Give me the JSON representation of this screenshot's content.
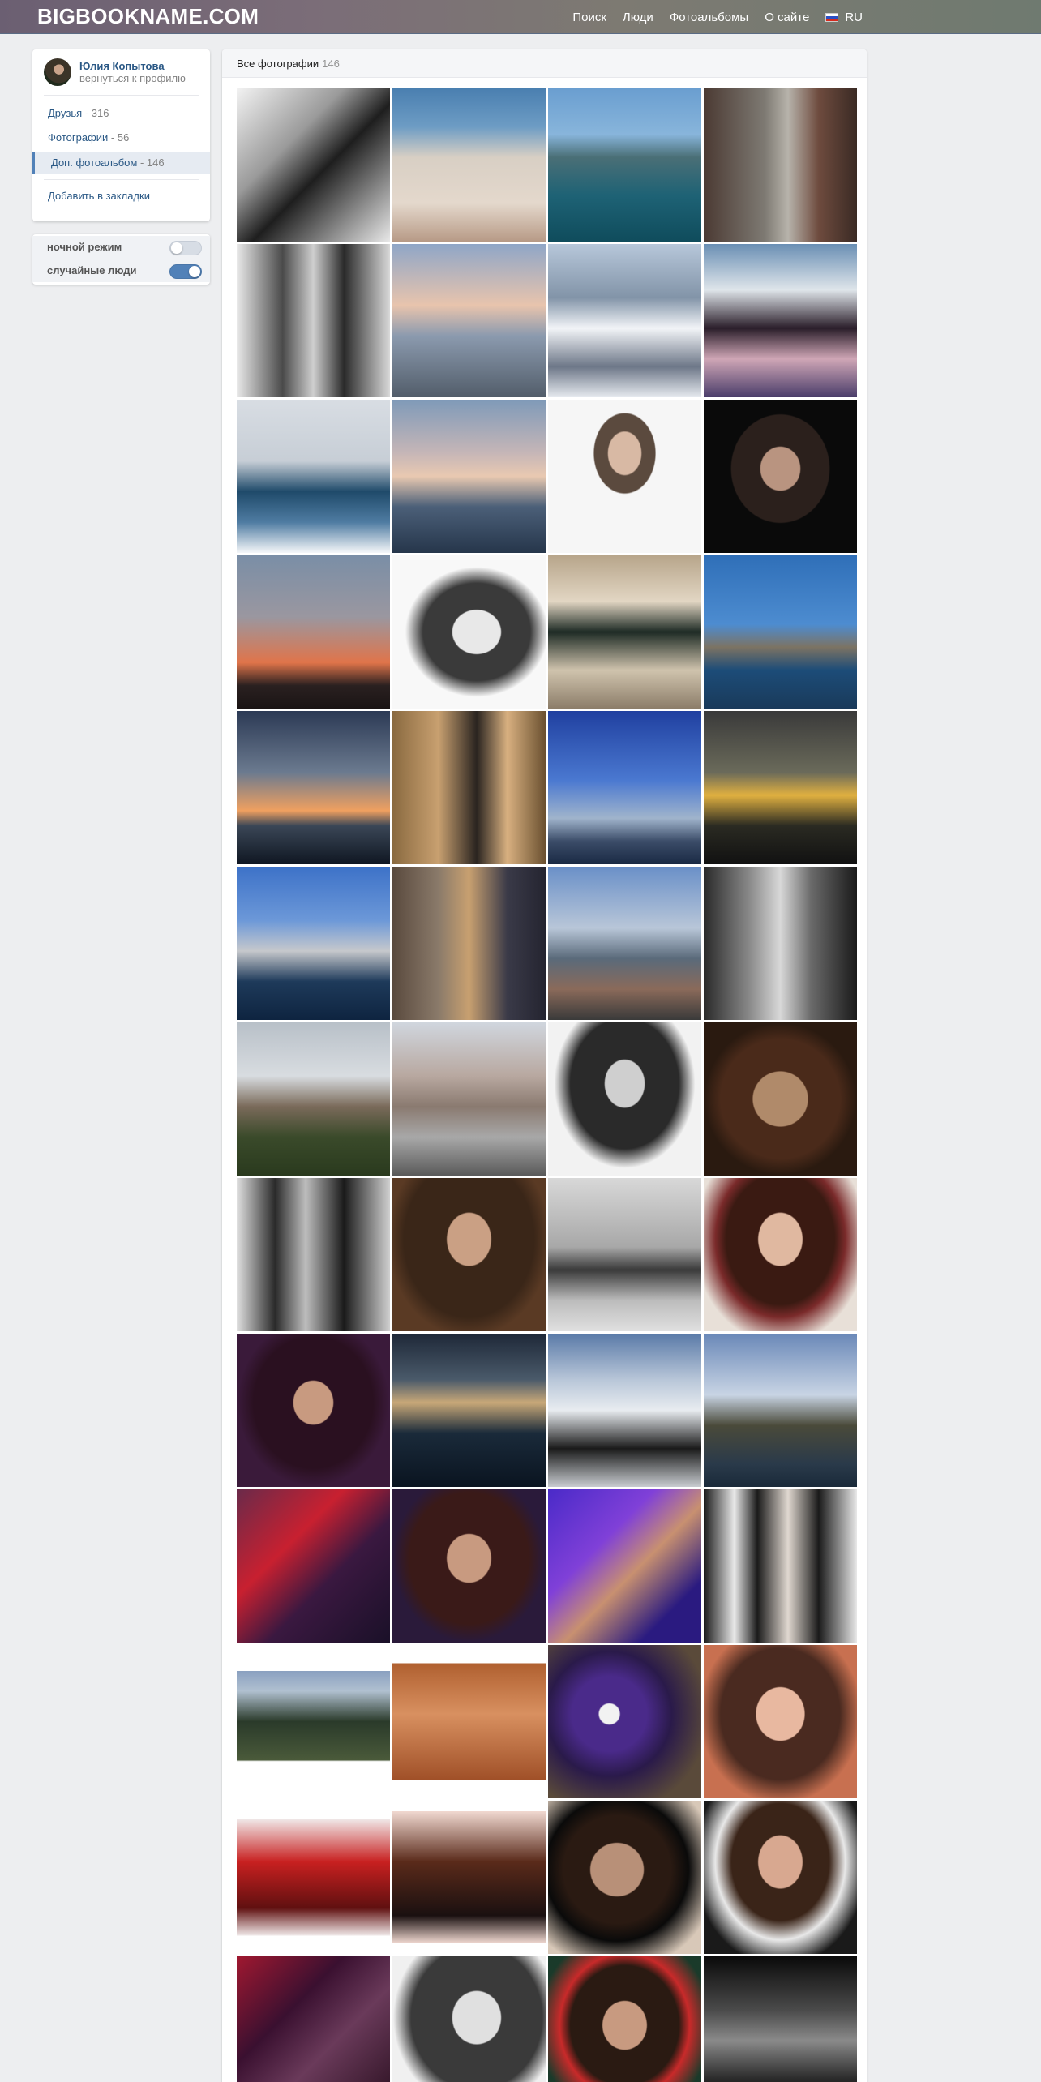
{
  "header": {
    "logo": "BIGBOOKNAME.COM",
    "nav": [
      "Поиск",
      "Люди",
      "Фотоальбомы",
      "О сайте"
    ],
    "lang": "RU"
  },
  "profile": {
    "name": "Юлия Копытова",
    "back": "вернуться к профилю",
    "menu": [
      {
        "label": "Друзья",
        "count": "316"
      },
      {
        "label": "Фотографии",
        "count": "56"
      },
      {
        "label": "Доп. фотоальбом",
        "count": "146"
      }
    ],
    "bookmark": "Добавить в закладки"
  },
  "toggles": [
    {
      "label": "ночной режим",
      "on": false
    },
    {
      "label": "случайные люди",
      "on": true
    }
  ],
  "album": {
    "title": "Все фотографии",
    "count": "146"
  },
  "photos": [
    {
      "bg": "linear-gradient(135deg,#f2f2f2 0%,#9a9a9a 35%,#1e1e1e 55%,#e8e8e8 100%)"
    },
    {
      "bg": "linear-gradient(180deg,#4a7fb0 0%,#6d9cc4 25%,#d8cfc4 45%,#e4d8cc 75%,#b79a86 100%)"
    },
    {
      "bg": "linear-gradient(180deg,#6a9ed0 0%,#88b5db 30%,#4a6f76 45%,#1e6275 70%,#0f4c5c 100%)"
    },
    {
      "bg": "linear-gradient(90deg,#4b3a33 0%,#7e7a73 40%,#b7b3ab 55%,#6e4b3e 75%,#3a2a24 100%)"
    },
    {
      "bg": "linear-gradient(90deg,#e9e9e9 0%,#4a4a4a 30%,#cfcfcf 50%,#2a2a2a 70%,#d9d9d9 100%)"
    },
    {
      "bg": "linear-gradient(180deg,#8fa6c7 0%,#e8c4ad 40%,#8b9aae 60%,#525d6a 100%)"
    },
    {
      "bg": "linear-gradient(180deg,#b7c7da 0%,#8294a8 35%,#f2f4f7 55%,#6d7788 80%,#e6eaef 100%)"
    },
    {
      "bg": "linear-gradient(180deg,#6a8fb4 0%,#dfe5ea 30%,#2a1e2a 55%,#cfa6b6 75%,#4a3d6a 100%)"
    },
    {
      "bg": "linear-gradient(180deg,#d8dde3 0%,#c7ced6 40%,#1f4a6a 60%,#4f7ca2 80%,#f5f7f9 100%)"
    },
    {
      "bg": "linear-gradient(180deg,#7f9ab8 0%,#c6b6b7 35%,#e9c9b1 50%,#4b5f78 70%,#26364b 100%)"
    },
    {
      "bg": "radial-gradient(ellipse at 50% 35%,#d8b9a4 0 15%,#5b4a3e 16% 28%,#f6f6f6 29%),linear-gradient(#f6f6f6,#f6f6f6)"
    },
    {
      "bg": "radial-gradient(ellipse at 50% 45%,#b99480 0 18%,#2b201c 19% 45%,#0a0a0a 46%)"
    },
    {
      "bg": "linear-gradient(180deg,#7a8ea6 0%,#9a97a0 40%,#e0744a 70%,#2a2020 85%,#1a1414 100%)"
    },
    {
      "bg": "radial-gradient(ellipse at 55% 50%,#e8e8e8 0 20%,#3a3a3a 21% 45%,#f8f8f8 60%)"
    },
    {
      "bg": "linear-gradient(180deg,#b7a58a 0%,#e2d6c3 30%,#1e2b25 50%,#cfc3ad 75%,#8c7d69 100%)"
    },
    {
      "bg": "linear-gradient(180deg,#2f6fb8 0%,#4d8cd0 45%,#7c7363 60%,#1c4c78 75%,#1a3a5a 100%)"
    },
    {
      "bg": "linear-gradient(180deg,#2c3a55 0%,#6b7a8f 40%,#f0a060 65%,#3a4656 75%,#0f1622 100%)"
    },
    {
      "bg": "linear-gradient(90deg,#8a6a40 0%,#c8a070 30%,#2a2420 55%,#d8b080 75%,#6a5030 100%)"
    },
    {
      "bg": "linear-gradient(180deg,#2040a0 0%,#4a78d0 45%,#a0b4cc 70%,#3b4c68 85%,#1a2a44 100%)"
    },
    {
      "bg": "linear-gradient(180deg,#3a3a3a 0%,#6a6a5a 40%,#e0b040 55%,#2a2a22 75%,#111 100%)"
    },
    {
      "bg": "linear-gradient(180deg,#3d72c8 0%,#6c98d8 35%,#c6c8cc 55%,#1e3a5a 75%,#0e2440 100%)"
    },
    {
      "bg": "linear-gradient(90deg,#5a4a3e 0%,#8a7a6a 30%,#c8a070 50%,#3a3a48 75%,#242430 100%)"
    },
    {
      "bg": "linear-gradient(180deg,#6a90c8 0%,#b8c6d8 40%,#5a6a7a 60%,#8a6a5a 80%,#3a3a3a 100%)"
    },
    {
      "bg": "linear-gradient(90deg,#2a2a2a 0%,#8a8a8a 30%,#d8d8d8 50%,#6a6a6a 70%,#1a1a1a 100%)"
    },
    {
      "bg": "linear-gradient(180deg,#b8c0c8 0%,#d8dce0 35%,#7a6a5a 55%,#3a4a2a 75%,#2a3a1e 100%)"
    },
    {
      "bg": "linear-gradient(180deg,#d0d6de 0%,#b8a8a0 35%,#8a7a70 55%,#a8a8a8 75%,#5a5a5a 100%)"
    },
    {
      "bg": "radial-gradient(ellipse at 50% 40%,#cfcfcf 0 18%,#2a2a2a 19% 50%,#f2f2f2 65%)"
    },
    {
      "bg": "radial-gradient(ellipse at 50% 50%,#b08a6a 0 25%,#4a2a1a 26% 55%,#2a1a10 70%)"
    },
    {
      "bg": "linear-gradient(90deg,#e0e0e0 0%,#2a2a2a 25%,#bdbdbd 45%,#1a1a1a 70%,#d0d0d0 100%)"
    },
    {
      "bg": "radial-gradient(ellipse at 50% 40%,#caa084 0 20%,#3a2618 21% 60%,#5a3a24 75%)"
    },
    {
      "bg": "linear-gradient(180deg,#d8d8d8 0%,#a8a8a8 45%,#3a3a3a 60%,#bcbcbc 80%,#e0e0e0 100%)"
    },
    {
      "bg": "radial-gradient(ellipse at 50% 40%,#e0b8a0 0 20%,#3a1a12 21% 50%,#7a2a2a 60%,#e8e0d8 80%)"
    },
    {
      "bg": "radial-gradient(ellipse at 50% 45%,#c89a80 0 18%,#2a1020 19% 55%,#3a1a3a 70%)"
    },
    {
      "bg": "linear-gradient(180deg,#1e2838 0%,#4a5a6a 30%,#c8a878 45%,#1a2a3a 65%,#0a1420 100%)"
    },
    {
      "bg": "linear-gradient(180deg,#5a7aa8 0%,#b8c6d8 30%,#e8ecf0 50%,#1a1a1a 75%,#c8ccd0 100%)"
    },
    {
      "bg": "linear-gradient(180deg,#6a88b8 0%,#c8d4e4 40%,#4a4a3a 60%,#2a3a4a 85%,#1a2a3a 100%)"
    },
    {
      "bg": "linear-gradient(135deg,#6a2a4a 0%,#c82030 35%,#3a1840 60%,#1a1028 100%)"
    },
    {
      "bg": "radial-gradient(ellipse at 50% 45%,#c89a80 0 20%,#3a1a18 21% 55%,#2a1a3a 70%)"
    },
    {
      "bg": "linear-gradient(135deg,#4a2ac8 0%,#8040d8 35%,#c89070 55%,#2a1a80 80%)"
    },
    {
      "bg": "linear-gradient(90deg,#1a1a1a 0%,#e8e8e8 20%,#1a1a1a 35%,#e0d8d0 55%,#1a1a1a 75%,#e8e8e8 100%)"
    },
    {
      "bg": "linear-gradient(180deg,#ffffff 0%,#ffffff 17%,#8aa0c0 17%,#b0c0d0 30%,#2a3a2a 50%,#4a5a3a 75%,#ffffff 76%,#ffffff 100%)"
    },
    {
      "bg": "linear-gradient(180deg,#ffffff 0%,#ffffff 12%,#b06030 12%,#d89060 45%,#a05028 88%,#ffffff 88%,#ffffff 100%)"
    },
    {
      "bg": "radial-gradient(circle at 40% 45%,#f2f2f2 0 8%,#4a2a8a 9% 30%,#2a1a4a 50%,#5a4a3a 80%)"
    },
    {
      "bg": "radial-gradient(ellipse at 50% 45%,#e8b8a0 0 22%,#4a2a20 23% 55%,#c87050 75%)"
    },
    {
      "bg": "linear-gradient(180deg,#ffffff 0%,#ffffff 12%,#f0e8e8 12%,#c82020 40%,#601010 70%,#f0e8e8 88%,#ffffff 88%,#ffffff 100%)"
    },
    {
      "bg": "linear-gradient(180deg,#ffffff 0%,#ffffff 7%,#f0d8d0 7%,#5a2a1a 40%,#1a1010 75%,#f0d8d0 93%,#ffffff 93%,#ffffff 100%)"
    },
    {
      "bg": "radial-gradient(ellipse at 45% 45%,#b89078 0 22%,#2a1a12 23% 45%,#0a0a0a 60%,#d8c8b8 85%)"
    },
    {
      "bg": "radial-gradient(ellipse at 50% 40%,#d8a890 0 20%,#3a2418 21% 45%,#e8e8e8 60%,#1a1a1a 80%)"
    },
    {
      "bg": "linear-gradient(135deg,#a01830 0%,#3a1030 35%,#6a3a5a 60%,#2a1020 100%)"
    },
    {
      "bg": "radial-gradient(ellipse at 55% 40%,#e0e0e0 0 20%,#3a3a3a 21% 55%,#f0f0f0 70%)"
    },
    {
      "bg": "radial-gradient(ellipse at 50% 45%,#c89a80 0 20%,#2a1a12 21% 50%,#c82a2a 60%,#1a3a2a 80%)"
    },
    {
      "bg": "linear-gradient(180deg,#0a0a0a 0%,#4a4a4a 35%,#8a8a8a 55%,#2a2a2a 80%,#0a0a0a 100%)"
    }
  ]
}
